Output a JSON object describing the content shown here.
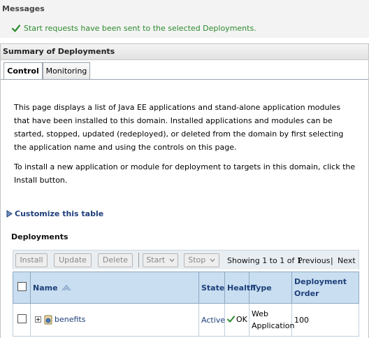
{
  "messages": {
    "title": "Messages",
    "text": "Start requests have been sent to the selected Deployments."
  },
  "summary": {
    "title": "Summary of Deployments",
    "tabs": [
      {
        "label": "Control"
      },
      {
        "label": "Monitoring"
      }
    ],
    "paragraph1": "This page displays a list of Java EE applications and stand-alone application modules that have been installed to this domain. Installed applications and modules can be started, stopped, updated (redeployed), or deleted from the domain by first selecting the application name and using the controls on this page.",
    "paragraph2": "To install a new application or module for deployment to targets in this domain, click the Install button.",
    "customize_label": "Customize this table"
  },
  "deployments": {
    "title": "Deployments",
    "toolbar": {
      "install": "Install",
      "update": "Update",
      "delete": "Delete",
      "start": "Start",
      "stop": "Stop",
      "showing": "Showing 1 to 1 of 1",
      "previous": "Previous",
      "separator": "|",
      "next": "Next"
    },
    "columns": {
      "name": "Name",
      "state": "State",
      "health": "Health",
      "type": "Type",
      "order": "Deployment Order"
    },
    "rows": [
      {
        "name": "benefits",
        "state": "Active",
        "health": "OK",
        "type": "Web Application",
        "order": "100"
      }
    ]
  },
  "colors": {
    "success": "#2e8b2e",
    "link": "#1e3f7a",
    "header_bg": "#c9def0"
  },
  "icons": [
    "check-icon",
    "expand-plus-icon",
    "web-app-icon",
    "sort-arrows-icon",
    "dropdown-chevron-icon",
    "customize-triangle-icon"
  ]
}
